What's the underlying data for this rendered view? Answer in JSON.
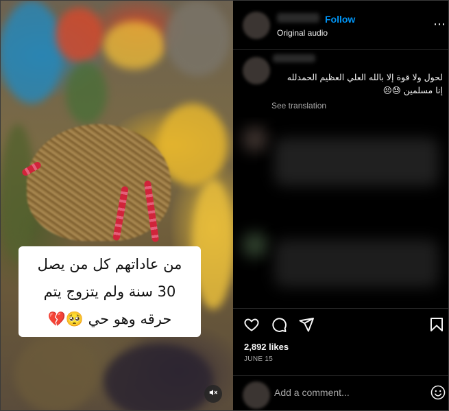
{
  "post": {
    "video": {
      "caption_lines": [
        "من عاداتهم كل من يصل",
        "30 سنة ولم يتزوج يتم",
        "حرقه وهو حي 🥺💔"
      ],
      "mute_icon": "speaker-muted-icon"
    },
    "header": {
      "follow_label": "Follow",
      "audio_label": "Original audio",
      "more_icon": "more-options-icon"
    },
    "main_comment": {
      "text_line1": "لحول ولا قوة إلا بالله العلي العظيم الحمدلله",
      "text_line2": "إنا مسلمين 😓😣",
      "see_translation_label": "See translation"
    },
    "actions": {
      "like_icon": "heart-icon",
      "comment_icon": "comment-bubble-icon",
      "share_icon": "paper-plane-icon",
      "save_icon": "bookmark-icon"
    },
    "stats": {
      "likes_text": "2,892 likes",
      "date_text": "JUNE 15"
    },
    "add_comment": {
      "placeholder": "Add a comment...",
      "emoji_icon": "emoji-smiley-icon"
    },
    "colors": {
      "background": "#000000",
      "accent_follow": "#0095f6",
      "secondary_text": "#a8a8a8",
      "divider": "#262626"
    }
  }
}
